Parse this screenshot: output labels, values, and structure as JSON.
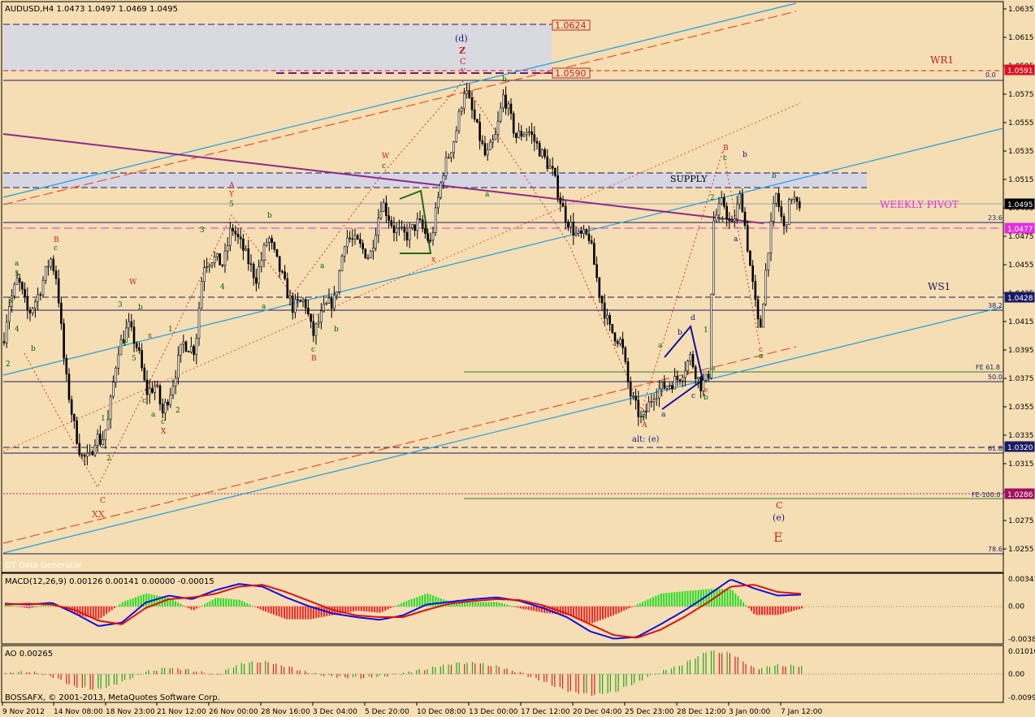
{
  "window": {
    "symbol_line": "AUDUSD,H4  1.0473 1.0497 1.0469 1.0495",
    "data_generator": "DT Data Generator",
    "copyright": "BOSSAFX, © 2001-2013, MetaQuotes Software Corp."
  },
  "colors": {
    "background": "#F5DEB3",
    "candle": "#000000",
    "channel_blue": "#1E9FE0",
    "channel_red": "#E8502A",
    "trend_purple": "#8B2A8B",
    "pivot_magenta": "#E030E0",
    "fib_navy": "#1A1A66",
    "macd_blue": "#1010E0",
    "macd_red": "#E01010",
    "hist_green": "#22DD22",
    "hist_red": "#EE2222",
    "wave_green": "#006400",
    "wave_red": "#C02020",
    "wave_navy": "#101080"
  },
  "chart_data": [
    {
      "type": "candlestick",
      "title": "AUDUSD,H4",
      "ohlc_last": {
        "open": 1.0473,
        "high": 1.0497,
        "low": 1.0469,
        "close": 1.0495
      },
      "ylim": [
        1.0238,
        1.0642
      ],
      "y_ticks": [
        "1.0635",
        "1.0615",
        "1.0595",
        "1.0575",
        "1.0555",
        "1.0535",
        "1.0515",
        "1.0495",
        "1.0475",
        "1.0455",
        "1.0435",
        "1.0415",
        "1.0395",
        "1.0375",
        "1.0355",
        "1.0335",
        "1.0315",
        "1.0295",
        "1.0275",
        "1.0255"
      ],
      "x_ticks": [
        "9 Nov 2012",
        "14 Nov 08:00",
        "18 Nov 23:00",
        "21 Nov 12:00",
        "26 Nov 00:00",
        "28 Nov 16:00",
        "3 Dec 04:00",
        "5 Dec 20:00",
        "10 Dec 08:00",
        "13 Dec 00:00",
        "17 Dec 12:00",
        "20 Dec 04:00",
        "25 Dec 23:00",
        "28 Dec 12:00",
        "3 Jan 00:00",
        "7 Jan 12:00"
      ],
      "price_path": [
        [
          0,
          1.0385
        ],
        [
          10,
          1.0425
        ],
        [
          22,
          1.0445
        ],
        [
          35,
          1.042
        ],
        [
          48,
          1.0435
        ],
        [
          62,
          1.046
        ],
        [
          70,
          1.0445
        ],
        [
          80,
          1.038
        ],
        [
          90,
          1.0345
        ],
        [
          100,
          1.032
        ],
        [
          110,
          1.0318
        ],
        [
          118,
          1.0335
        ],
        [
          125,
          1.033
        ],
        [
          133,
          1.0345
        ],
        [
          145,
          1.0395
        ],
        [
          158,
          1.0412
        ],
        [
          170,
          1.0395
        ],
        [
          180,
          1.0365
        ],
        [
          192,
          1.037
        ],
        [
          200,
          1.035
        ],
        [
          212,
          1.037
        ],
        [
          225,
          1.04
        ],
        [
          240,
          1.0395
        ],
        [
          250,
          1.0455
        ],
        [
          262,
          1.046
        ],
        [
          275,
          1.0455
        ],
        [
          285,
          1.0482
        ],
        [
          300,
          1.0465
        ],
        [
          315,
          1.0445
        ],
        [
          330,
          1.0475
        ],
        [
          345,
          1.045
        ],
        [
          360,
          1.0425
        ],
        [
          375,
          1.043
        ],
        [
          385,
          1.0405
        ],
        [
          400,
          1.0425
        ],
        [
          412,
          1.043
        ],
        [
          425,
          1.0475
        ],
        [
          440,
          1.047
        ],
        [
          455,
          1.046
        ],
        [
          470,
          1.05
        ],
        [
          485,
          1.048
        ],
        [
          500,
          1.0475
        ],
        [
          515,
          1.0485
        ],
        [
          530,
          1.047
        ],
        [
          545,
          1.052
        ],
        [
          560,
          1.0545
        ],
        [
          572,
          1.058
        ],
        [
          585,
          1.0555
        ],
        [
          598,
          1.053
        ],
        [
          610,
          1.0545
        ],
        [
          620,
          1.0575
        ],
        [
          635,
          1.0545
        ],
        [
          650,
          1.055
        ],
        [
          665,
          1.0535
        ],
        [
          680,
          1.052
        ],
        [
          695,
          1.049
        ],
        [
          710,
          1.0475
        ],
        [
          725,
          1.0475
        ],
        [
          738,
          1.0435
        ],
        [
          750,
          1.041
        ],
        [
          765,
          1.04
        ],
        [
          775,
          1.0365
        ],
        [
          790,
          1.0345
        ],
        [
          805,
          1.0365
        ],
        [
          820,
          1.037
        ],
        [
          835,
          1.0375
        ],
        [
          850,
          1.039
        ],
        [
          862,
          1.037
        ],
        [
          872,
          1.0375
        ],
        [
          878,
          1.0485
        ],
        [
          890,
          1.05
        ],
        [
          900,
          1.048
        ],
        [
          912,
          1.0505
        ],
        [
          922,
          1.046
        ],
        [
          935,
          1.0405
        ],
        [
          945,
          1.0465
        ],
        [
          955,
          1.0505
        ],
        [
          965,
          1.048
        ],
        [
          975,
          1.0505
        ],
        [
          985,
          1.049
        ]
      ],
      "levels": [
        {
          "label": "1.0624",
          "value": 1.0624,
          "style": "navy-dash"
        },
        {
          "label": "1.0591",
          "value": 1.0591,
          "style": "red-dash",
          "name": "WR1"
        },
        {
          "label": "1.0590",
          "value": 1.059,
          "style": "red-box"
        },
        {
          "label": "0.0",
          "value": 1.0586,
          "style": "fib"
        },
        {
          "label": "1.0495",
          "value": 1.0495,
          "style": "current"
        },
        {
          "label": "23.6",
          "value": 1.0478,
          "style": "fib"
        },
        {
          "label": "1.0477",
          "value": 1.0477,
          "style": "pivot",
          "name": "WEEKLY PIVOT"
        },
        {
          "label": "1.0428",
          "value": 1.0428,
          "style": "navy-dash",
          "name": "WS1"
        },
        {
          "label": "38.2",
          "value": 1.0421,
          "style": "fib"
        },
        {
          "label": "FE 61.8",
          "value": 1.0376,
          "style": "green"
        },
        {
          "label": "50.0",
          "value": 1.0366,
          "style": "fib"
        },
        {
          "label": "1.0320",
          "value": 1.032,
          "style": "navy-dash"
        },
        {
          "label": "61.8",
          "value": 1.0316,
          "style": "fib"
        },
        {
          "label": "1.0286",
          "value": 1.0286,
          "style": "red-dot"
        },
        {
          "label": "FE-100.0",
          "value": 1.0284,
          "style": "green"
        },
        {
          "label": "78.6",
          "value": 1.0243,
          "style": "fib"
        }
      ],
      "zones": [
        {
          "label": "",
          "from": 1.059,
          "to": 1.0624
        },
        {
          "label": "SUPPLY",
          "from": 1.0505,
          "to": 1.0518
        }
      ],
      "annotations": [
        {
          "text": "WR1",
          "color": "red"
        },
        {
          "text": "WEEKLY PIVOT",
          "color": "magenta"
        },
        {
          "text": "WS1",
          "color": "navy"
        },
        {
          "text": "SUPPLY",
          "color": "black"
        },
        {
          "text": "(d)",
          "color": "navy"
        },
        {
          "text": "Z",
          "color": "red"
        },
        {
          "text": "C",
          "color": "red"
        },
        {
          "text": "Y",
          "color": "red"
        },
        {
          "text": "alt: (e)",
          "color": "navy"
        },
        {
          "text": "(e)",
          "color": "navy"
        },
        {
          "text": "E",
          "color": "red"
        },
        {
          "text": "XX",
          "color": "red"
        }
      ]
    },
    {
      "type": "bar",
      "title": "MACD(12,26,9) 0.00126 0.00141 0.00000 -0.00015",
      "ylim": [
        -0.00382,
        0.00341
      ],
      "y_ticks": [
        "0.00341",
        "0.00",
        "-0.00382"
      ],
      "series": [
        {
          "name": "MACD",
          "values": [
            0.0003,
            0.0002,
            0.0004,
            -0.0008,
            -0.0022,
            -0.0018,
            0.0004,
            0.0012,
            0.0008,
            0.0018,
            0.0025,
            0.0022,
            0.001,
            0.0,
            -0.0008,
            -0.0012,
            -0.0015,
            -0.001,
            0.0002,
            0.0005,
            0.0008,
            0.001,
            0.0006,
            -0.0002,
            -0.0012,
            -0.0028,
            -0.0036,
            -0.0034,
            -0.002,
            -0.0005,
            0.0012,
            0.003,
            0.002,
            0.0012,
            0.0013
          ]
        },
        {
          "name": "Signal",
          "values": [
            0.0002,
            0.0003,
            0.0002,
            -0.0004,
            -0.0016,
            -0.002,
            -0.0002,
            0.0008,
            0.001,
            0.0014,
            0.0022,
            0.0024,
            0.0016,
            0.0006,
            -0.0004,
            -0.001,
            -0.0012,
            -0.0012,
            -0.0004,
            0.0003,
            0.0006,
            0.0008,
            0.0007,
            0.0001,
            -0.0008,
            -0.002,
            -0.0032,
            -0.0035,
            -0.0026,
            -0.0012,
            0.0004,
            0.0022,
            0.0024,
            0.0016,
            0.0014
          ]
        }
      ]
    },
    {
      "type": "bar",
      "title": "AO 0.00265",
      "ylim": [
        -0.00999,
        0.0101
      ],
      "y_ticks": [
        "0.01010",
        "0.00",
        "-0.00999"
      ],
      "series": [
        {
          "name": "AO",
          "values": [
            0.0005,
            0.001,
            -0.001,
            -0.005,
            -0.006,
            -0.003,
            0.001,
            0.0025,
            0.0015,
            -0.0005,
            0.004,
            0.005,
            0.003,
            0.0005,
            -0.001,
            -0.0015,
            -0.001,
            0.0005,
            0.002,
            0.004,
            0.0045,
            0.003,
            0.0005,
            -0.003,
            -0.0065,
            -0.008,
            -0.007,
            -0.003,
            0.001,
            0.004,
            0.009,
            0.008,
            0.002,
            0.0035,
            0.003
          ]
        }
      ]
    }
  ]
}
